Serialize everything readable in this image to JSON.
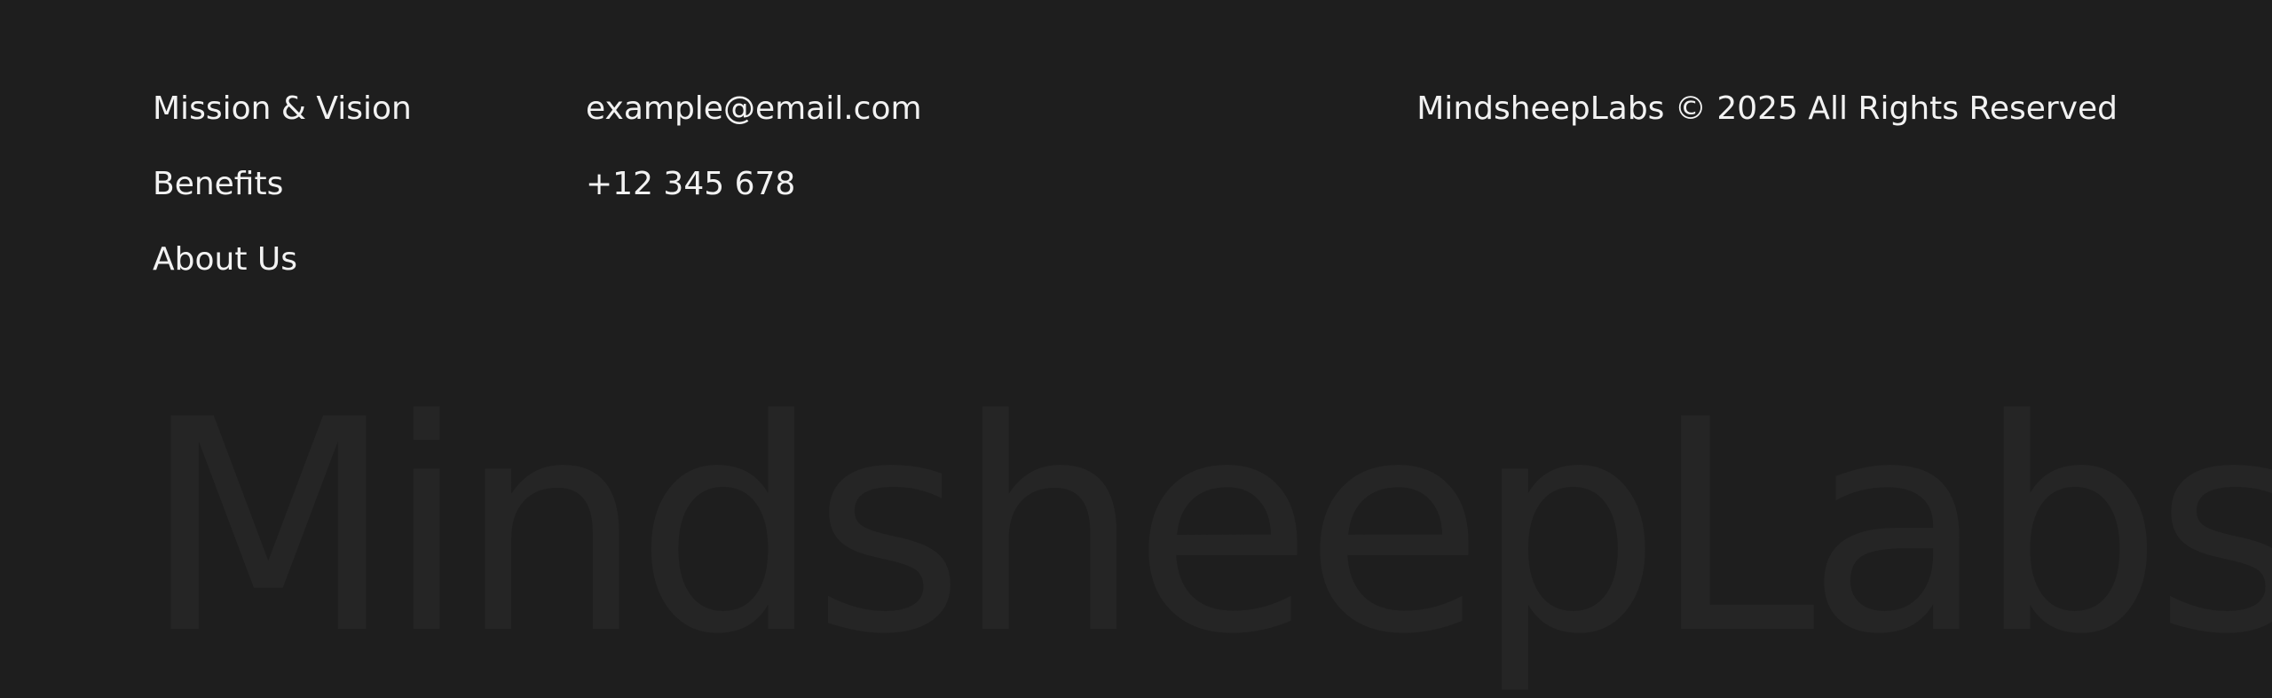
{
  "footer": {
    "nav_links": [
      {
        "label": "Mission & Vision"
      },
      {
        "label": "Benefits"
      },
      {
        "label": "About Us"
      }
    ],
    "contact": {
      "email": "example@email.com",
      "phone": "+12 345 678"
    },
    "copyright": "MindsheepLabs © 2025 All Rights Reserved",
    "watermark": "MindsheepLabs"
  },
  "colors": {
    "background": "#1e1e1e",
    "text": "#f2f2f2",
    "watermark": "#252525"
  }
}
